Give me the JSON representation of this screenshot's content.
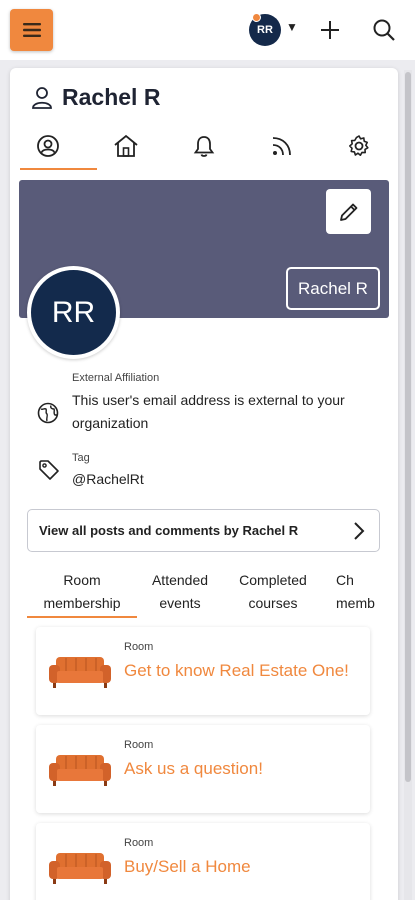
{
  "header": {
    "avatar_initials": "RR",
    "accent": "#f0883e",
    "menu_icon": "hamburger-menu-icon",
    "add_icon": "plus-icon",
    "search_icon": "search-icon"
  },
  "profile": {
    "name": "Rachel R",
    "initials": "RR",
    "banner_name": "Rachel R",
    "banner_color": "#595b79"
  },
  "icon_tabs": [
    {
      "name": "profile-icon",
      "active": true
    },
    {
      "name": "home-icon",
      "active": false
    },
    {
      "name": "bell-icon",
      "active": false
    },
    {
      "name": "feed-icon",
      "active": false
    },
    {
      "name": "gear-icon",
      "active": false
    }
  ],
  "info": {
    "affiliation_label": "External Affiliation",
    "affiliation_text": "This user's email address is external to your organization",
    "tag_label": "Tag",
    "tag_value": "@RachelRt"
  },
  "view_posts_label": "View all posts and comments by Rachel R",
  "sub_tabs": [
    {
      "label": "Room\nmembership",
      "active": true
    },
    {
      "label": "Attended\nevents",
      "active": false
    },
    {
      "label": "Completed\ncourses",
      "active": false
    },
    {
      "label": "Ch\nmemb",
      "active": false
    }
  ],
  "rooms": [
    {
      "type": "Room",
      "name": "Get to know Real Estate One!"
    },
    {
      "type": "Room",
      "name": "Ask us a question!"
    },
    {
      "type": "Room",
      "name": "Buy/Sell a Home"
    }
  ]
}
